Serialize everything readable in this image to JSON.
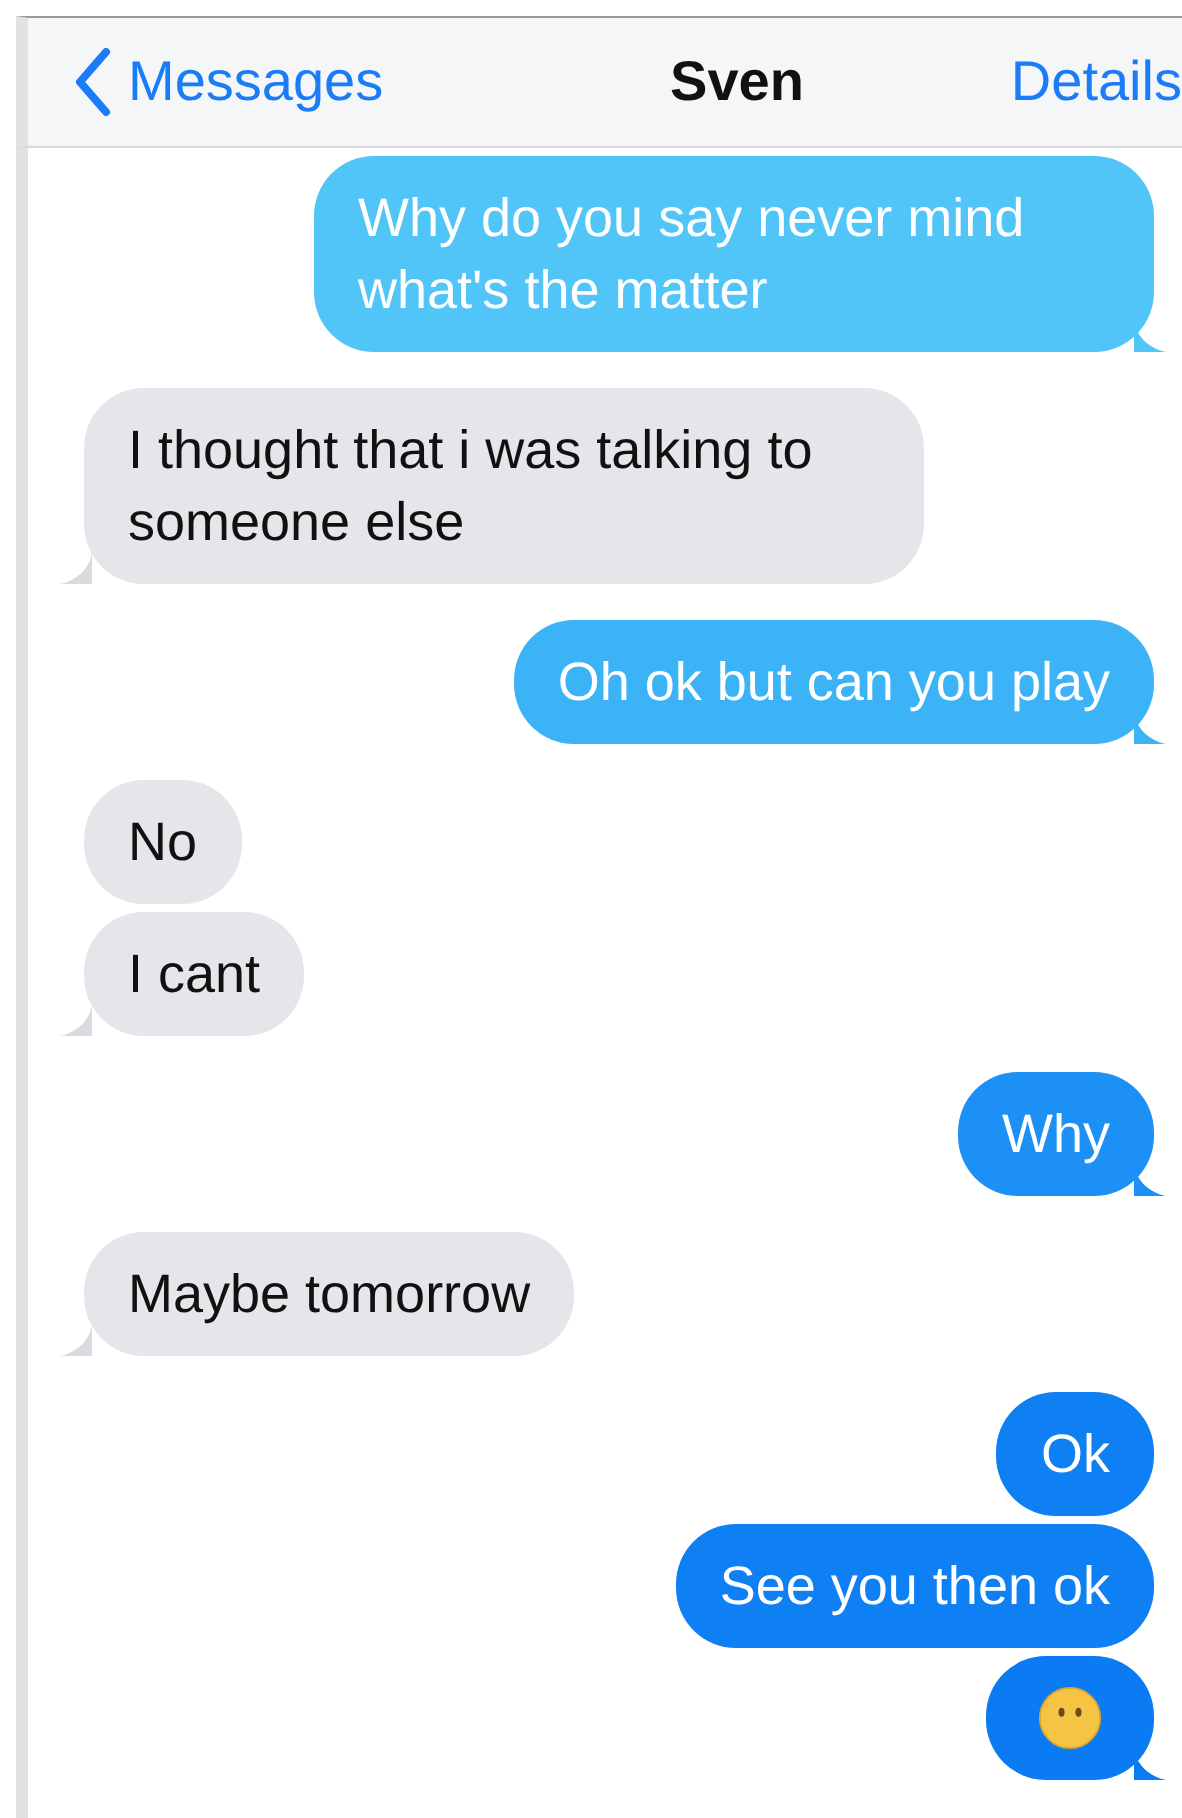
{
  "nav": {
    "back": "Messages",
    "title": "Sven",
    "action": "Details"
  },
  "messages": [
    {
      "sent": true,
      "kind": "text",
      "text": "Why do you say never mind what's the matter",
      "tail": true
    },
    {
      "sent": false,
      "kind": "text",
      "text": "I thought that i was talking to someone else",
      "tail": true
    },
    {
      "sent": true,
      "kind": "text",
      "text": "Oh ok but can you play",
      "tail": true
    },
    {
      "sent": false,
      "kind": "text",
      "text": "No",
      "tail": false
    },
    {
      "sent": false,
      "kind": "text",
      "text": "I cant",
      "tail": true
    },
    {
      "sent": true,
      "kind": "text",
      "text": "Why",
      "tail": true
    },
    {
      "sent": false,
      "kind": "text",
      "text": "Maybe tomorrow",
      "tail": true
    },
    {
      "sent": true,
      "kind": "text",
      "text": "Ok",
      "tail": false
    },
    {
      "sent": true,
      "kind": "text",
      "text": "See you then ok",
      "tail": false
    },
    {
      "sent": true,
      "kind": "emoji",
      "tail": true
    }
  ]
}
